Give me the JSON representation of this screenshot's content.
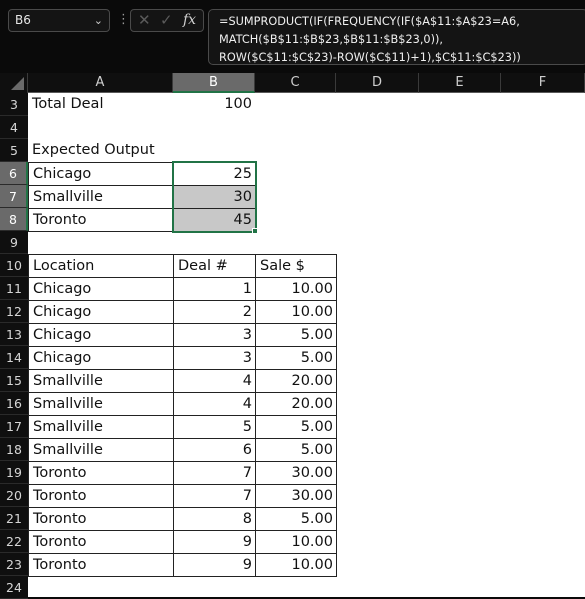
{
  "formula_bar": {
    "name_box": "B6",
    "name_box_chevron": "⌄",
    "cancel_icon": "✕",
    "enter_icon": "✓",
    "fx_label": "fx",
    "formula": "=SUMPRODUCT(IF(FREQUENCY(IF($A$11:$A$23=A6,\nMATCH($B$11:$B$23,$B$11:$B$23,0)),\nROW($C$11:$C$23)-ROW($C$11)+1),$C$11:$C$23))"
  },
  "columns": [
    "A",
    "B",
    "C",
    "D",
    "E",
    "F"
  ],
  "selected_column": "B",
  "rows": [
    "3",
    "4",
    "5",
    "6",
    "7",
    "8",
    "9",
    "10",
    "11",
    "12",
    "13",
    "14",
    "15",
    "16",
    "17",
    "18",
    "19",
    "20",
    "21",
    "22",
    "23",
    "24"
  ],
  "selected_rows": [
    "6",
    "7",
    "8"
  ],
  "colors": {
    "selection": "#217346",
    "shade": "#c8c8c8",
    "header_selected": "#6a6a6a"
  },
  "summary": {
    "total_label": "Total Deal",
    "total_value": "100",
    "expected_label": "Expected Output",
    "expected": [
      {
        "location": "Chicago",
        "value": "25"
      },
      {
        "location": "Smallville",
        "value": "30"
      },
      {
        "location": "Toronto",
        "value": "45"
      }
    ]
  },
  "table": {
    "headers": [
      "Location",
      "Deal #",
      "Sale $"
    ],
    "rows": [
      [
        "Chicago",
        "1",
        "10.00"
      ],
      [
        "Chicago",
        "2",
        "10.00"
      ],
      [
        "Chicago",
        "3",
        "5.00"
      ],
      [
        "Chicago",
        "3",
        "5.00"
      ],
      [
        "Smallville",
        "4",
        "20.00"
      ],
      [
        "Smallville",
        "4",
        "20.00"
      ],
      [
        "Smallville",
        "5",
        "5.00"
      ],
      [
        "Smallville",
        "6",
        "5.00"
      ],
      [
        "Toronto",
        "7",
        "30.00"
      ],
      [
        "Toronto",
        "7",
        "30.00"
      ],
      [
        "Toronto",
        "8",
        "5.00"
      ],
      [
        "Toronto",
        "9",
        "10.00"
      ],
      [
        "Toronto",
        "9",
        "10.00"
      ]
    ]
  }
}
